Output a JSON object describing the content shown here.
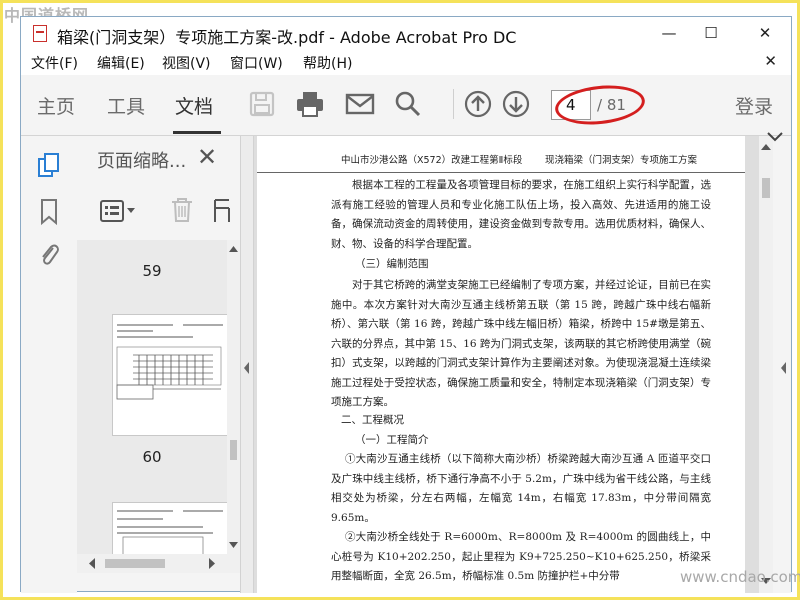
{
  "watermarks": {
    "top_left": "中国道桥网",
    "bottom_right": "www.cndao.com"
  },
  "window": {
    "title": "箱梁(门洞支架）专项施工方案-改.pdf - Adobe Acrobat Pro DC",
    "controls": {
      "minimize": "—",
      "maximize": "☐",
      "close": "✕"
    }
  },
  "menu": {
    "items": [
      "文件(F)",
      "编辑(E)",
      "视图(V)",
      "窗口(W)",
      "帮助(H)"
    ],
    "close": "✕"
  },
  "toolbar": {
    "tabs": [
      "主页",
      "工具",
      "文档"
    ],
    "active_tab": "文档",
    "tools": [
      "save-icon",
      "print-icon",
      "email-icon",
      "search-icon",
      "prev-page-icon",
      "next-page-icon"
    ],
    "current_page": "4",
    "total_pages": "/ 81",
    "login": "登录",
    "highlight_color": "#d41f1f"
  },
  "sidebar": {
    "icons": [
      "page-thumbnails-icon",
      "bookmark-icon",
      "attachment-icon"
    ],
    "panel_title": "页面缩略...",
    "panel_close": "✕",
    "thumbnails": [
      {
        "number": "59"
      },
      {
        "number": "60"
      },
      {
        "number": ""
      }
    ]
  },
  "document": {
    "header_left": "中山市沙港公路（X572）改建工程第Ⅱ标段",
    "header_right": "现浇箱梁（门洞支架）专项施工方案",
    "paragraphs": [
      "根据本工程的工程量及各项管理目标的要求，在施工组织上实行科学配置，选派有施工经验的管理人员和专业化施工队伍上场，投入高效、先进适用的施工设备，确保流动资金的周转使用，建设资金做到专款专用。选用优质材料，确保人、财、物、设备的科学合理配置。",
      "（三）编制范围",
      "对于其它桥跨的满堂支架施工已经编制了专项方案，并经过论证，目前已在实施中。本次方案针对大南沙互通主线桥第五联（第 15 跨，跨越广珠中线右幅新桥）、第六联（第 16 跨，跨越广珠中线左幅旧桥）箱梁，桥跨中 15#墩是第五、六联的分界点，其中第 15、16 跨为门洞式支架，该两联的其它桥跨使用满堂（碗扣）式支架，以跨越的门洞式支架计算作为主要阐述对象。为使现浇混凝土连续梁施工过程处于受控状态，确保施工质量和安全，特制定本现浇箱梁（门洞支架）专项施工方案。",
      "二、工程概况",
      "（一）工程简介",
      "①大南沙互通主线桥（以下简称大南沙桥）桥梁跨越大南沙互通 A 匝道平交口及广珠中线主线桥，桥下通行净高不小于 5.2m，广珠中线为省干线公路，与主线相交处为桥梁，分左右两幅，左幅宽 14m，右幅宽 17.83m，中分带间隔宽 9.65m。",
      "②大南沙桥全线处于 R=6000m、R=8000m 及 R=4000m 的圆曲线上，中心桩号为 K10+202.250，起止里程为 K9+725.250~K10+625.250，桥梁采用整幅断面，全宽 26.5m，桥幅标准 0.5m 防撞护栏+中分带"
    ]
  }
}
